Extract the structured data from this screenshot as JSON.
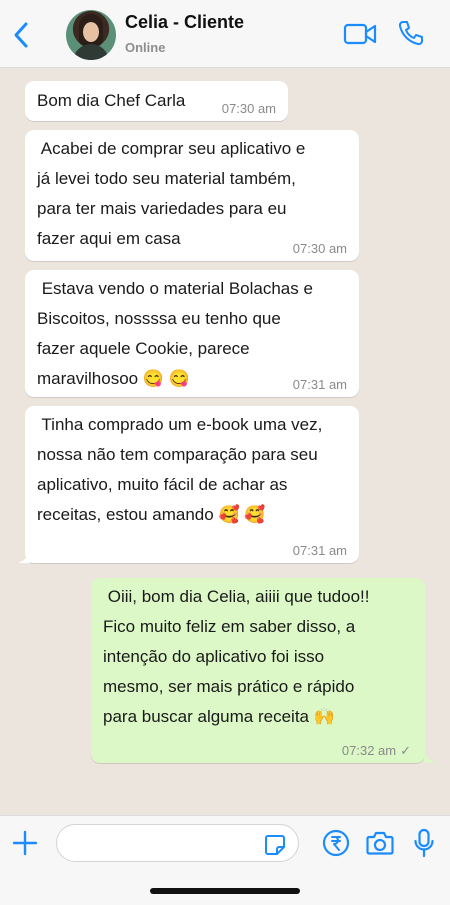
{
  "header": {
    "contact_name": "Celia - Cliente",
    "status": "Online"
  },
  "messages": [
    {
      "direction": "in",
      "lines": [
        "Bom dia Chef Carla"
      ],
      "time": "07:30 am"
    },
    {
      "direction": "in",
      "lines": [
        " Acabei de comprar seu aplicativo e",
        "já levei todo seu material também,",
        "para ter mais variedades para eu",
        "fazer aqui em casa"
      ],
      "time": "07:30 am"
    },
    {
      "direction": "in",
      "lines": [
        " Estava vendo o material Bolachas e",
        "Biscoitos, nossssa eu tenho que",
        "fazer aquele Cookie, parece",
        "maravilhosoo 😋 😋"
      ],
      "time": "07:31 am"
    },
    {
      "direction": "in",
      "lines": [
        " Tinha comprado um e-book uma vez,",
        "nossa não tem comparação para seu",
        "aplicativo, muito fácil de achar as",
        "receitas, estou amando 🥰 🥰"
      ],
      "time": "07:31 am"
    },
    {
      "direction": "out",
      "lines": [
        " Oiii, bom dia Celia, aiiii que tudoo!!",
        "Fico muito feliz em saber disso, a",
        "intenção do aplicativo foi isso",
        "mesmo, ser mais prático e rápido",
        "para buscar alguma receita 🙌"
      ],
      "time": "07:32 am"
    }
  ],
  "composer": {
    "placeholder": ""
  },
  "colors": {
    "accent": "#1a8cff",
    "outgoing_bubble": "#dcf8c6",
    "incoming_bubble": "#ffffff",
    "chat_background": "#ece5dd"
  },
  "icons": [
    "chevron-left-icon",
    "video-camera-icon",
    "phone-icon",
    "plus-icon",
    "sticker-icon",
    "payment-icon",
    "camera-icon",
    "microphone-icon"
  ]
}
